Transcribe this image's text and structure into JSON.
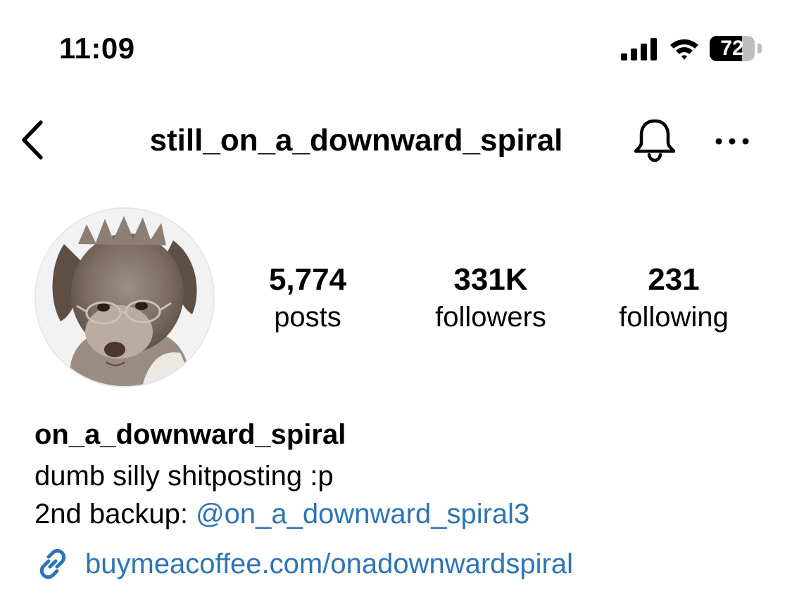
{
  "status_bar": {
    "time": "11:09",
    "battery_level": "72",
    "battery_fraction": 0.72,
    "icons": [
      "cellular-signal-icon",
      "wifi-icon",
      "battery-icon"
    ]
  },
  "header": {
    "username": "still_on_a_downward_spiral",
    "icons": [
      "back-chevron-icon",
      "bell-icon",
      "more-icon"
    ]
  },
  "profile": {
    "stats": {
      "posts": {
        "value": "5,774",
        "label": "posts"
      },
      "followers": {
        "value": "331K",
        "label": "followers"
      },
      "following": {
        "value": "231",
        "label": "following"
      }
    },
    "display_name": "on_a_downward_spiral",
    "bio": {
      "line1": "dumb silly shitposting :p",
      "line2_prefix": "2nd backup: ",
      "line2_mention": "@on_a_downward_spiral3"
    },
    "link": "buymeacoffee.com/onadownwardspiral",
    "cutoff_text_plain": "",
    "cutoff_text_bold": ""
  },
  "colors": {
    "link_blue": "#2c74b8",
    "text": "#000000",
    "background": "#ffffff"
  }
}
